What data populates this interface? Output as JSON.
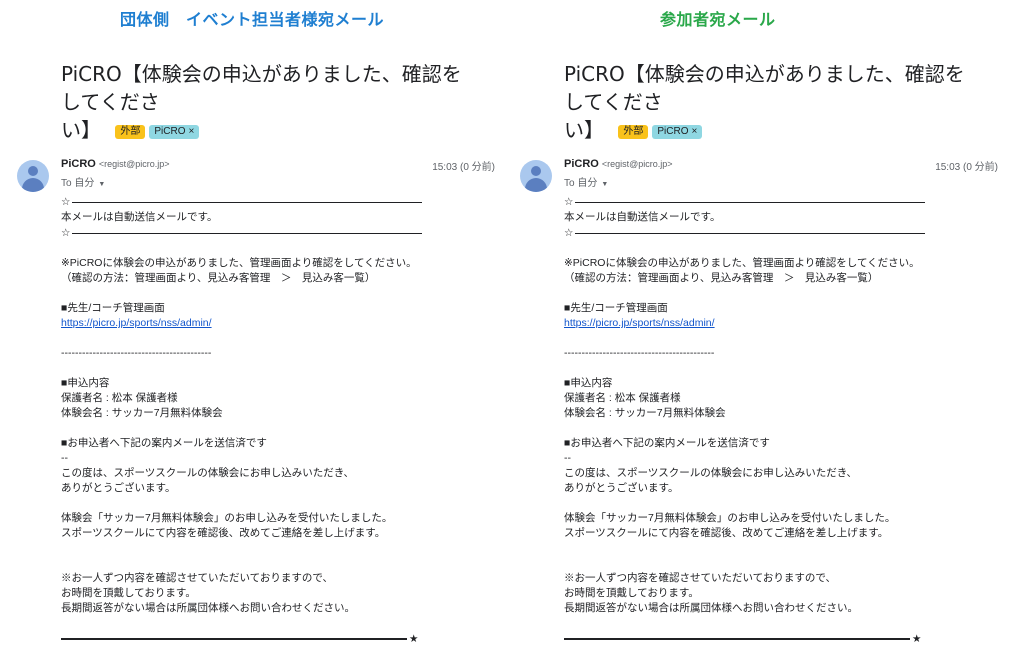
{
  "colors": {
    "left_heading": "#1f7fd1",
    "right_heading": "#2aa84a",
    "link": "#1155cc"
  },
  "headings": {
    "left": "団体側　イベント担当者様宛メール",
    "right": "参加者宛メール"
  },
  "email": {
    "subject": "PiCRO【体験会の申込がありました、確認をしてください】",
    "subject_line1": "PiCRO【体験会の申込がありました、確認をしてくださ",
    "subject_line2": "い】",
    "tag_external": "外部",
    "tag_picro": "PiCRO",
    "tag_close": "×",
    "sender_name": "PiCRO",
    "sender_email": "<regist@picro.jp>",
    "to_label": "To 自分",
    "time": "15:03 (0 分前)",
    "star": "☆",
    "star_end": "★",
    "lines": {
      "auto": "本メールは自動送信メールです。",
      "notice": "※PiCROに体験会の申込がありました、管理画面より確認をしてください。",
      "method": "（確認の方法：管理画面より、見込み客管理　＞　見込み客一覧）",
      "admin_heading": "■先生/コーチ管理画面",
      "admin_url": "https://picro.jp/sports/nss/admin/",
      "dashes": "-------------------------------------------",
      "content_heading": "■申込内容",
      "guardian": "保護者名 : 松本 保護者様",
      "event": "体験会名 : サッカー7月無料体験会",
      "sent_heading": "■お申込者へ下記の案内メールを送信済です",
      "double_dash": "--",
      "thanks1": "この度は、スポーツスクールの体験会にお申し込みいただき、",
      "thanks2": "ありがとうございます。",
      "accept1": "体験会「サッカー7月無料体験会」のお申し込みを受付いたしました。",
      "accept2": "スポーツスクールにて内容を確認後、改めてご連絡を差し上げます。",
      "note1": "※お一人ずつ内容を確認させていただいておりますので、",
      "note2": "お時間を頂戴しております。",
      "note3": "長期間返答がない場合は所属団体様へお問い合わせください。"
    }
  }
}
